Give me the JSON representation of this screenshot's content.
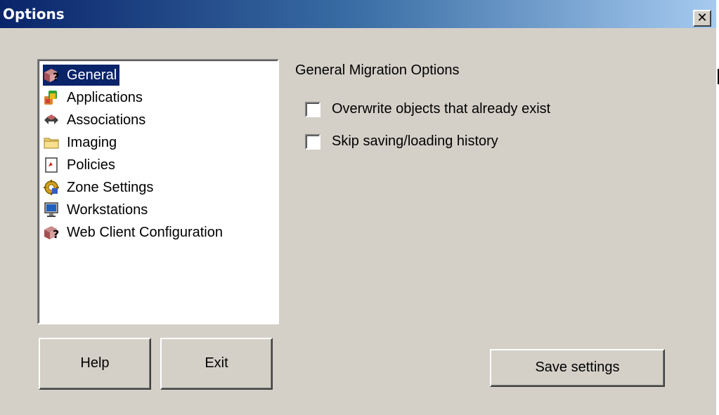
{
  "window": {
    "title": "Options",
    "close_glyph": "✕"
  },
  "sidebar": {
    "items": [
      {
        "label": "General",
        "icon": "question-package-icon",
        "selected": true
      },
      {
        "label": "Applications",
        "icon": "applications-icon",
        "selected": false
      },
      {
        "label": "Associations",
        "icon": "associations-icon",
        "selected": false
      },
      {
        "label": "Imaging",
        "icon": "folder-icon",
        "selected": false
      },
      {
        "label": "Policies",
        "icon": "policies-icon",
        "selected": false
      },
      {
        "label": "Zone Settings",
        "icon": "gear-icon",
        "selected": false
      },
      {
        "label": "Workstations",
        "icon": "monitor-icon",
        "selected": false
      },
      {
        "label": "Web Client Configuration",
        "icon": "question-package-icon",
        "selected": false
      }
    ]
  },
  "main": {
    "group_title": "General Migration Options",
    "options": [
      {
        "label": "Overwrite objects that already exist",
        "checked": false
      },
      {
        "label": "Skip saving/loading history",
        "checked": false
      }
    ]
  },
  "buttons": {
    "help": "Help",
    "exit": "Exit",
    "save": "Save settings"
  },
  "colors": {
    "selection": "#0a246a",
    "dialog_bg": "#d4d0c8"
  }
}
